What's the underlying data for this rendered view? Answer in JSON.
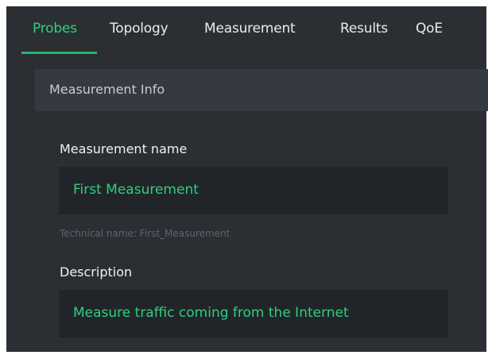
{
  "tabs": [
    {
      "label": "Probes",
      "active": true
    },
    {
      "label": "Topology",
      "active": false
    },
    {
      "label": "Measurement",
      "active": false
    },
    {
      "label": "Results",
      "active": false
    },
    {
      "label": "QoE",
      "active": false
    }
  ],
  "section": {
    "title": "Measurement Info"
  },
  "form": {
    "name": {
      "label": "Measurement name",
      "value": "First Measurement",
      "technical_name": "Technical name: First_Measurement"
    },
    "description": {
      "label": "Description",
      "value": "Measure traffic coming from the Internet"
    }
  },
  "colors": {
    "accent": "#2fcf7f",
    "background": "#2b2f33",
    "input_background": "#212529",
    "section_header": "#343a40"
  }
}
